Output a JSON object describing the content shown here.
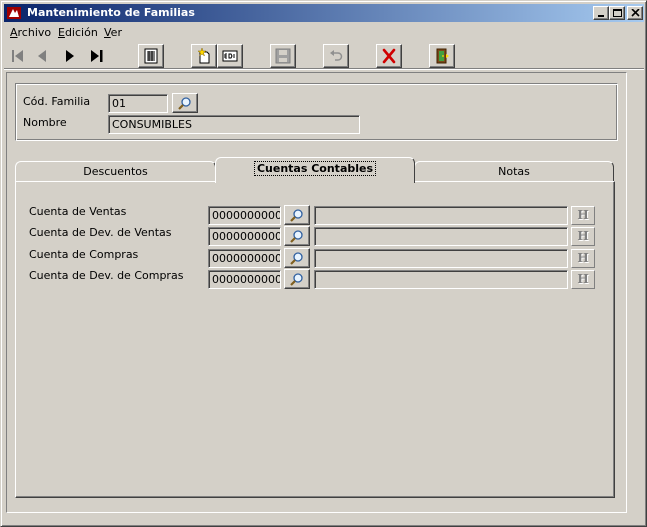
{
  "window": {
    "title": "Mantenimiento de Familias",
    "controls": [
      "minimize-icon",
      "maximize-icon",
      "close-icon"
    ]
  },
  "menubar": {
    "items": [
      "Archivo",
      "Edición",
      "Ver"
    ]
  },
  "toolbar": {
    "navigation": [
      "first-record-icon",
      "previous-record-icon",
      "next-record-icon",
      "last-record-icon"
    ],
    "buttons": [
      "grid-list-icon",
      "new-record-icon",
      "edit-record-icon",
      "save-icon",
      "undo-icon",
      "delete-icon",
      "exit-door-icon"
    ]
  },
  "header": {
    "cod_familia_label": "Cód. Familia",
    "cod_familia_value": "01",
    "nombre_label": "Nombre",
    "nombre_value": "CONSUMIBLES"
  },
  "tabs": [
    {
      "label": "Descuentos",
      "active": false
    },
    {
      "label": "Cuentas Contables",
      "active": true
    },
    {
      "label": "Notas",
      "active": false
    }
  ],
  "accounts": [
    {
      "label": "Cuenta de Ventas",
      "code": "0000000000",
      "description": ""
    },
    {
      "label": "Cuenta de Dev. de Ventas",
      "code": "0000000000",
      "description": ""
    },
    {
      "label": "Cuenta de Compras",
      "code": "0000000000",
      "description": ""
    },
    {
      "label": "Cuenta de Dev. de Compras",
      "code": "0000000000",
      "description": ""
    }
  ],
  "h_button_label": "H",
  "colors": {
    "title_start": "#0a246a",
    "title_end": "#a6caf0",
    "face": "#d4d0c8",
    "delete_red": "#d00000"
  }
}
